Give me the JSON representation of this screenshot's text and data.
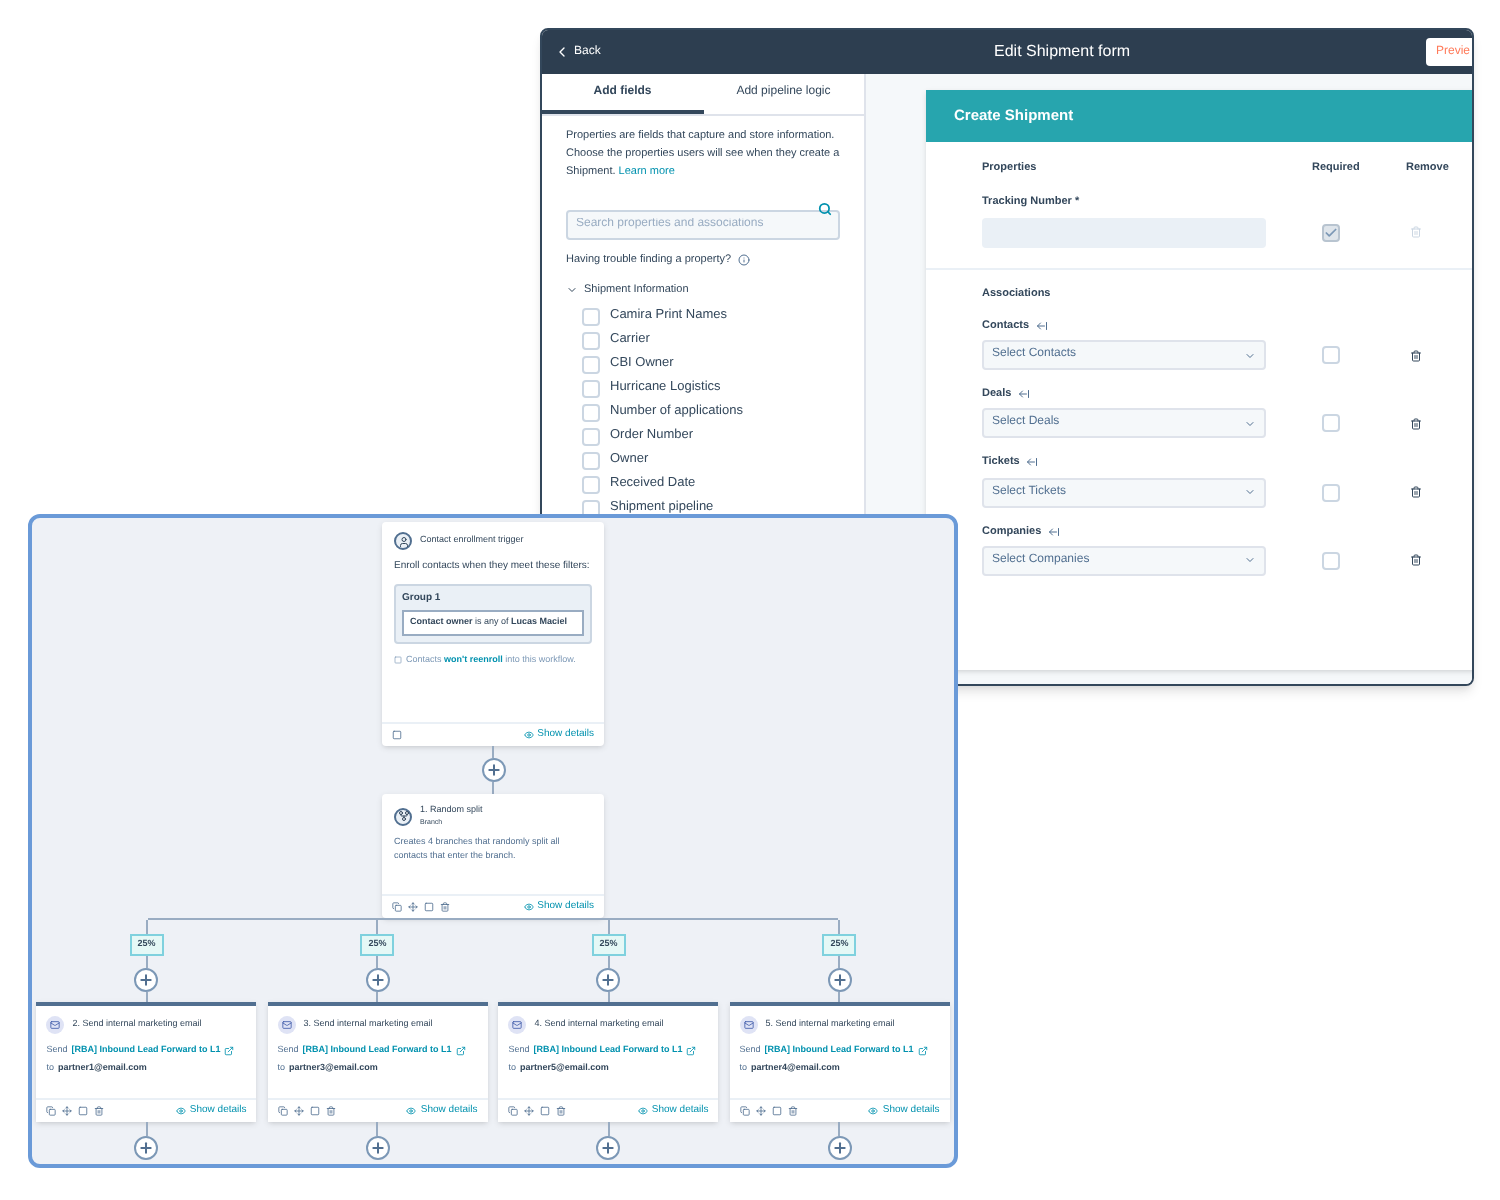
{
  "form_window": {
    "back": "Back",
    "title": "Edit Shipment form",
    "preview_button": "Previe",
    "tabs": [
      {
        "label": "Add fields",
        "selected": true
      },
      {
        "label": "Add pipeline logic",
        "selected": false
      }
    ],
    "intro": "Properties are fields that capture and store information. Choose the properties users will see when they create a Shipment.",
    "intro_link": "Learn more",
    "search": {
      "placeholder": "Search properties and associations"
    },
    "help_text": "Having trouble finding a property?",
    "group": {
      "label": "Shipment Information",
      "expanded": true,
      "properties": [
        {
          "label": "Camira Print Names",
          "checked": false
        },
        {
          "label": "Carrier",
          "checked": false
        },
        {
          "label": "CBI Owner",
          "checked": false
        },
        {
          "label": "Hurricane Logistics",
          "checked": false
        },
        {
          "label": "Number of applications",
          "checked": false
        },
        {
          "label": "Order Number",
          "checked": false
        },
        {
          "label": "Owner",
          "checked": false
        },
        {
          "label": "Received Date",
          "checked": false
        },
        {
          "label": "Shipment pipeline",
          "checked": false
        }
      ]
    },
    "form": {
      "title": "Create Shipment",
      "columns": [
        "Properties",
        "Required",
        "Remove"
      ],
      "fields": [
        {
          "label": "Tracking Number *",
          "required": true,
          "removable": false
        }
      ],
      "associations_heading": "Associations",
      "associations": [
        {
          "label": "Contacts",
          "placeholder": "Select Contacts",
          "required": false,
          "removable": true
        },
        {
          "label": "Deals",
          "placeholder": "Select Deals",
          "required": false,
          "removable": true
        },
        {
          "label": "Tickets",
          "placeholder": "Select Tickets",
          "required": false,
          "removable": true
        },
        {
          "label": "Companies",
          "placeholder": "Select Companies",
          "required": false,
          "removable": true
        }
      ]
    }
  },
  "workflow": {
    "trigger": {
      "title": "Contact enrollment trigger",
      "description": "Enroll contacts when they meet these filters:",
      "group_label": "Group 1",
      "filter": "**Contact owner** is any of **Lucas Maciel**",
      "note_before": "Contacts",
      "note_link": "won't reenroll",
      "note_after": "into this workflow.",
      "details": "Show details"
    },
    "split": {
      "title": "1. Random split",
      "subtitle": "Branch",
      "description": "Creates 4 branches that randomly split all contacts that enter the branch.",
      "details": "Show details"
    },
    "branches": [
      {
        "percent": "25%",
        "title": "2. Send internal marketing email",
        "send_prefix": "Send",
        "email_name": "[RBA] Inbound Lead Forward to L1",
        "to_prefix": "to",
        "recipient": "partner1@email.com",
        "details": "Show details"
      },
      {
        "percent": "25%",
        "title": "3. Send internal marketing email",
        "send_prefix": "Send",
        "email_name": "[RBA] Inbound Lead Forward to L1",
        "to_prefix": "to",
        "recipient": "partner3@email.com",
        "details": "Show details"
      },
      {
        "percent": "25%",
        "title": "4. Send internal marketing email",
        "send_prefix": "Send",
        "email_name": "[RBA] Inbound Lead Forward to L1",
        "to_prefix": "to",
        "recipient": "partner5@email.com",
        "details": "Show details"
      },
      {
        "percent": "25%",
        "title": "5. Send internal marketing email",
        "send_prefix": "Send",
        "email_name": "[RBA] Inbound Lead Forward to L1",
        "to_prefix": "to",
        "recipient": "partner4@email.com",
        "details": "Show details"
      }
    ]
  }
}
